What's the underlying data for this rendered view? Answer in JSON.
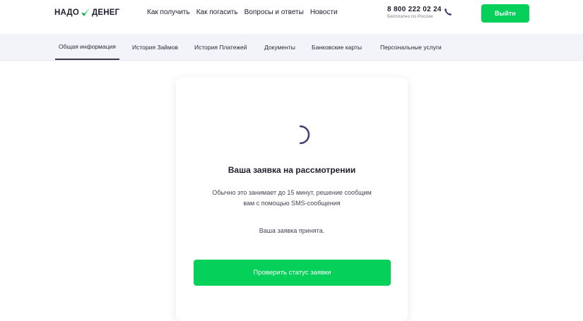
{
  "header": {
    "logo_left": "НАДО",
    "logo_right": "ДЕНЕГ",
    "nav": [
      "Как получить",
      "Как погасить",
      "Вопросы и ответы",
      "Новости"
    ],
    "phone": "8 800 222 02 24",
    "phone_note": "Бесплатно по России",
    "logout_label": "Выйти",
    "accent_color": "#05d15a"
  },
  "tabs": [
    {
      "label": "Общая информация",
      "active": true
    },
    {
      "label": "История Займов",
      "active": false
    },
    {
      "label": "История Платежей",
      "active": false
    },
    {
      "label": "Документы",
      "active": false
    },
    {
      "label": "Банковские карты",
      "active": false
    },
    {
      "label": "Персональные услуги",
      "active": false
    }
  ],
  "card": {
    "title": "Ваша заявка на рассмотрении",
    "description_line1": "Обычно это занимает до 15 минут, решение сообщим",
    "description_line2": "вам с помощью SMS-сообщения",
    "accepted": "Ваша заявка принята.",
    "button_label": "Проверить статус заявки"
  },
  "icons": {
    "logo_mark": "check-icon",
    "phone": "phone-icon",
    "loader": "spinner-icon"
  }
}
